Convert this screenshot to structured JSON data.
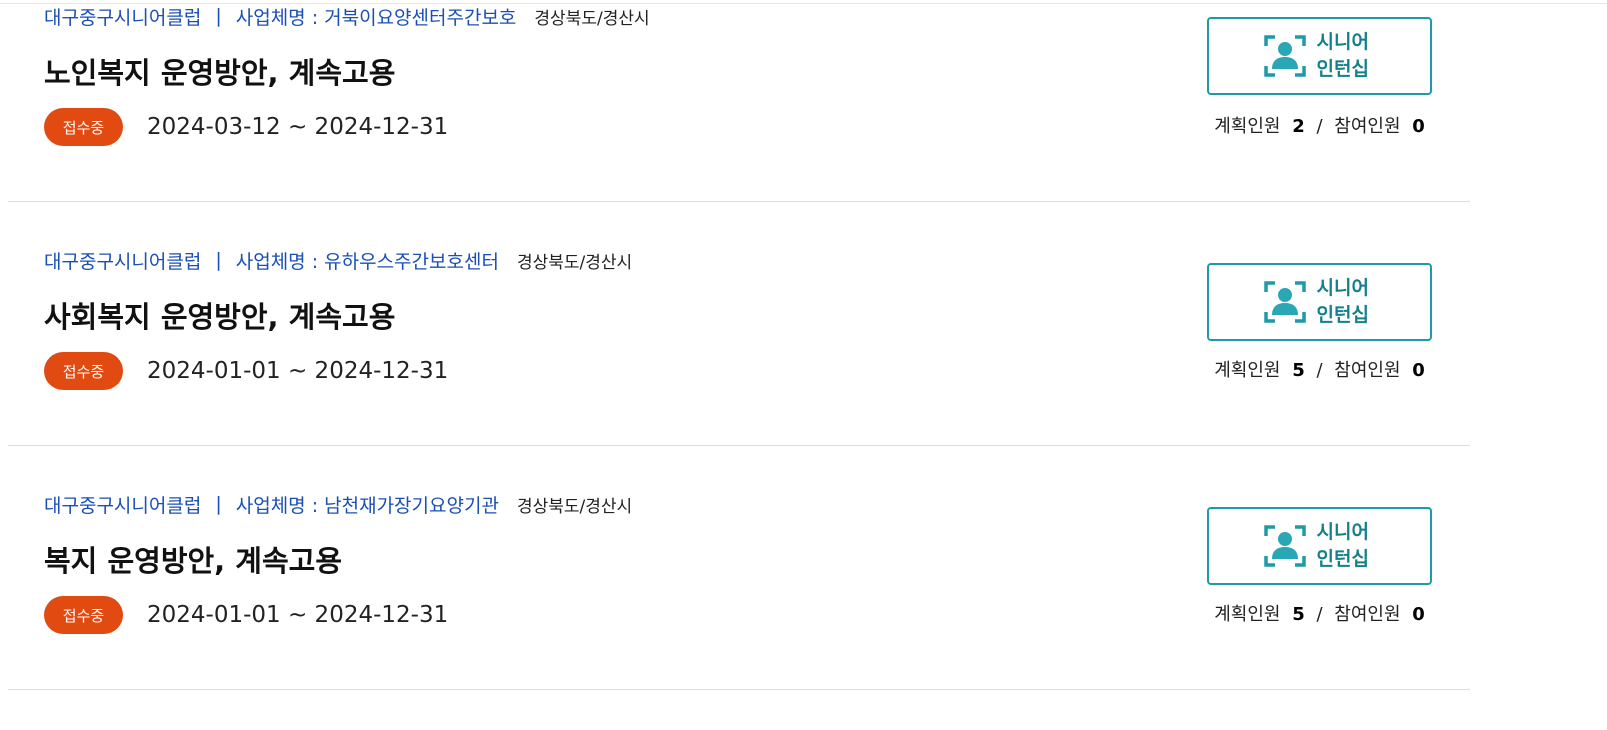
{
  "items": [
    {
      "club": "대구중구시니어클럽",
      "separator": "|",
      "business": "사업체명 : 거북이요양센터주간보호",
      "region": "경상북도/경산시",
      "title": "노인복지 운영방안, 계속고용",
      "status": "접수중",
      "period": "2024-03-12 ~ 2024-12-31",
      "type_line1": "시니어",
      "type_line2": "인턴십",
      "planned_label": "계획인원",
      "planned": "2",
      "count_sep": "/",
      "joined_label": "참여인원",
      "joined": "0"
    },
    {
      "club": "대구중구시니어클럽",
      "separator": "|",
      "business": "사업체명 : 유하우스주간보호센터",
      "region": "경상북도/경산시",
      "title": "사회복지 운영방안, 계속고용",
      "status": "접수중",
      "period": "2024-01-01 ~ 2024-12-31",
      "type_line1": "시니어",
      "type_line2": "인턴십",
      "planned_label": "계획인원",
      "planned": "5",
      "count_sep": "/",
      "joined_label": "참여인원",
      "joined": "0"
    },
    {
      "club": "대구중구시니어클럽",
      "separator": "|",
      "business": "사업체명 : 남천재가장기요양기관",
      "region": "경상북도/경산시",
      "title": "복지 운영방안, 계속고용",
      "status": "접수중",
      "period": "2024-01-01 ~ 2024-12-31",
      "type_line1": "시니어",
      "type_line2": "인턴십",
      "planned_label": "계획인원",
      "planned": "5",
      "count_sep": "/",
      "joined_label": "참여인원",
      "joined": "0"
    }
  ],
  "colors": {
    "link_blue": "#1a4fb5",
    "status_orange": "#e14b12",
    "teal": "#1e9aa8"
  },
  "icons": {
    "type_icon": "senior-person-frame-icon"
  }
}
